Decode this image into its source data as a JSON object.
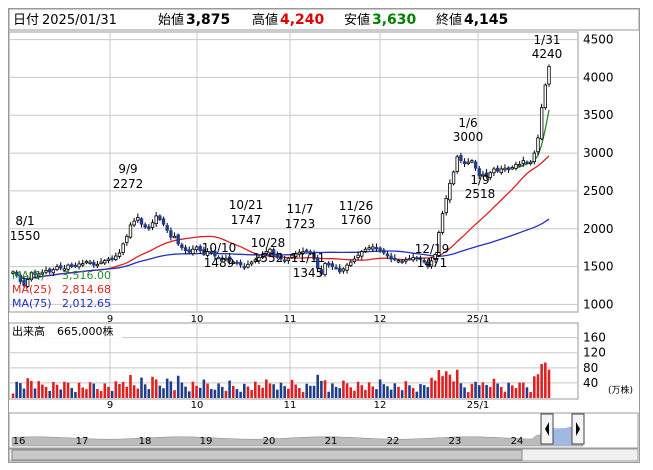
{
  "header": {
    "date_label": "日付",
    "date_value": "2025/01/31",
    "open_label": "始値",
    "open_value": "3,875",
    "high_label": "高値",
    "high_value": "4,240",
    "low_label": "安値",
    "low_value": "3,630",
    "close_label": "終値",
    "close_value": "4,145"
  },
  "colors": {
    "up": "#ffffff",
    "down": "#1f3d8c",
    "wick": "#000000",
    "ma5": "#2a8a2a",
    "ma25": "#e02020",
    "ma75": "#2030c0",
    "vol_up": "#e02020",
    "vol_down": "#1f3d8c",
    "text_black": "#000000",
    "text_red": "#e00000",
    "text_green": "#008000",
    "grid": "#c8c8c8",
    "nav_fill": "#bcbcbc",
    "nav_sel": "#9ab8e8"
  },
  "chart_data": [
    {
      "type": "candlestick",
      "title": "",
      "ylim": [
        900,
        4600
      ],
      "y_ticks": [
        "1000",
        "1500",
        "2000",
        "2500",
        "3000",
        "3500",
        "4000",
        "4500"
      ],
      "x_tick_labels": [
        "9",
        "10",
        "11",
        "12",
        "25/1"
      ],
      "annotations": [
        {
          "date": "8/1",
          "value": "1550"
        },
        {
          "date": "9/9",
          "value": "2272"
        },
        {
          "date": "10/10",
          "value": "1489"
        },
        {
          "date": "10/21",
          "value": "1747"
        },
        {
          "date": "10/28",
          "value": "1552"
        },
        {
          "date": "11/7",
          "value": "1723"
        },
        {
          "date": "11/11",
          "value": "1345"
        },
        {
          "date": "11/26",
          "value": "1760"
        },
        {
          "date": "12/19",
          "value": "1471"
        },
        {
          "date": "1/6",
          "value": "3000"
        },
        {
          "date": "1/9",
          "value": "2518"
        },
        {
          "date": "1/31",
          "value": "4240"
        }
      ],
      "ma_legend": [
        {
          "name": "MA(5)",
          "value": "3,516.00"
        },
        {
          "name": "MA(25)",
          "value": "2,814.68"
        },
        {
          "name": "MA(75)",
          "value": "2,012.65"
        }
      ],
      "close": [
        1430,
        1380,
        1300,
        1250,
        1330,
        1420,
        1390,
        1405,
        1420,
        1450,
        1430,
        1460,
        1500,
        1480,
        1470,
        1520,
        1500,
        1510,
        1535,
        1540,
        1570,
        1560,
        1520,
        1530,
        1560,
        1580,
        1600,
        1610,
        1640,
        1680,
        1800,
        1900,
        2050,
        2100,
        2150,
        2060,
        2020,
        2000,
        2080,
        2170,
        2120,
        2060,
        1980,
        1890,
        1900,
        1800,
        1750,
        1710,
        1690,
        1730,
        1760,
        1710,
        1660,
        1700,
        1690,
        1640,
        1620,
        1600,
        1610,
        1570,
        1560,
        1545,
        1520,
        1500,
        1530,
        1560,
        1590,
        1620,
        1660,
        1700,
        1730,
        1660,
        1620,
        1600,
        1580,
        1610,
        1650,
        1670,
        1690,
        1700,
        1710,
        1680,
        1600,
        1480,
        1400,
        1540,
        1520,
        1500,
        1480,
        1430,
        1470,
        1520,
        1560,
        1600,
        1650,
        1700,
        1730,
        1750,
        1760,
        1740,
        1700,
        1680,
        1640,
        1600,
        1590,
        1580,
        1570,
        1590,
        1600,
        1620,
        1605,
        1600,
        1560,
        1500,
        1575,
        1660,
        1950,
        2200,
        2400,
        2600,
        2750,
        2950,
        2900,
        2860,
        2880,
        2900,
        2800,
        2700,
        2720,
        2690,
        2740,
        2790,
        2760,
        2790,
        2800,
        2780,
        2810,
        2850,
        2850,
        2900,
        2870,
        2880,
        3000,
        3200,
        3600,
        3900,
        4145
      ]
    },
    {
      "type": "bar",
      "title": "出来高",
      "value_label": "665,000株",
      "unit": "(万株)",
      "ylim": [
        0,
        175
      ],
      "y_ticks": [
        "40",
        "80",
        "120",
        "160"
      ],
      "x_tick_labels": [
        "9",
        "10",
        "11",
        "12",
        "25/1"
      ]
    },
    {
      "type": "area",
      "x_tick_labels": [
        "16",
        "17",
        "18",
        "19",
        "20",
        "21",
        "22",
        "23",
        "24"
      ]
    }
  ]
}
